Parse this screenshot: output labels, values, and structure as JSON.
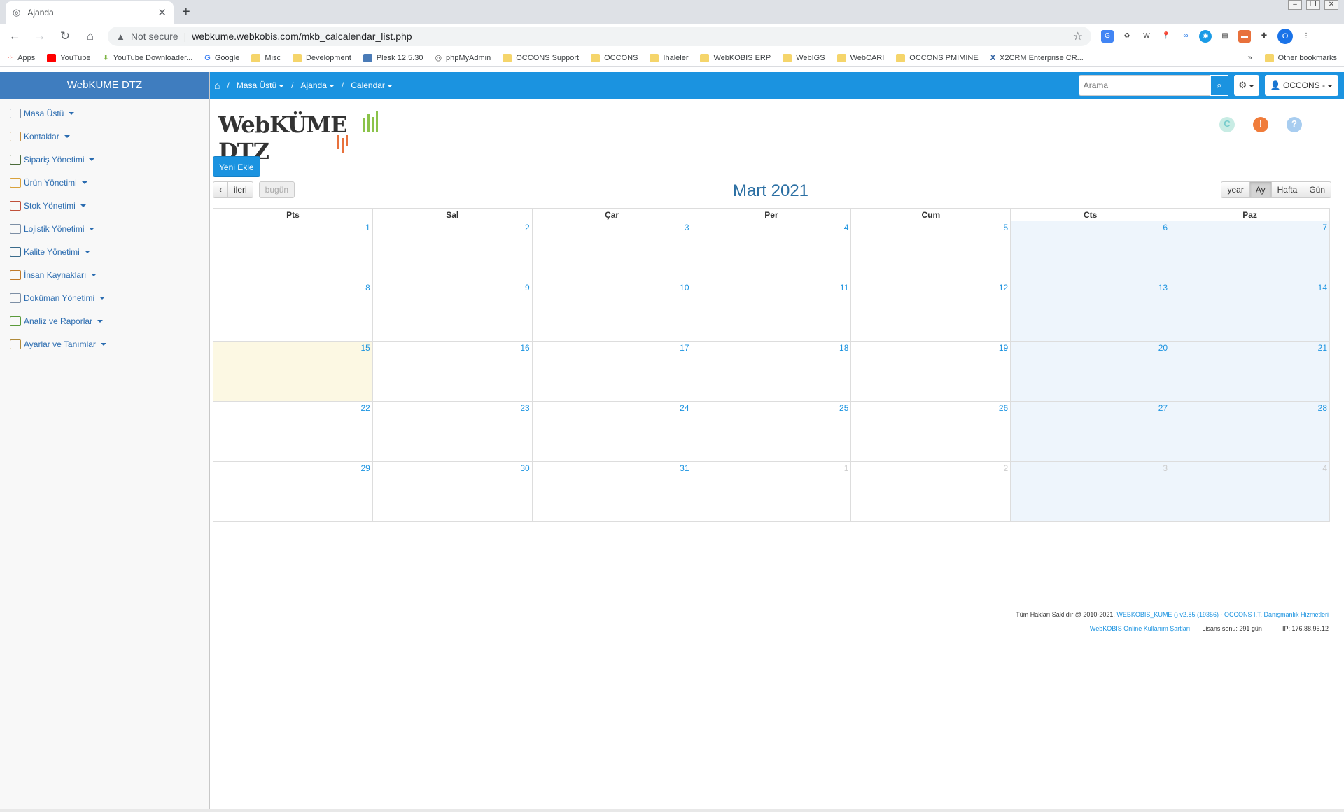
{
  "browser": {
    "tab_title": "Ajanda",
    "security_label": "Not secure",
    "url": "webkume.webkobis.com/mkb_calcalendar_list.php",
    "profile_initial": "O",
    "bookmarks": [
      "Apps",
      "YouTube",
      "YouTube Downloader...",
      "Google",
      "Misc",
      "Development",
      "Plesk 12.5.30",
      "phpMyAdmin",
      "OCCONS Support",
      "OCCONS",
      "Ihaleler",
      "WebKOBIS ERP",
      "WebIGS",
      "WebCARI",
      "OCCONS PMIMINE",
      "X2CRM Enterprise CR..."
    ],
    "more_bookmarks": "»",
    "other_bookmarks": "Other bookmarks"
  },
  "sidebar": {
    "brand": "WebKUME DTZ",
    "items": [
      {
        "label": "Masa Üstü",
        "icon": "desktop-icon"
      },
      {
        "label": "Kontaklar",
        "icon": "contacts-icon"
      },
      {
        "label": "Sipariş Yönetimi",
        "icon": "orders-icon"
      },
      {
        "label": "Ürün Yönetimi",
        "icon": "products-icon"
      },
      {
        "label": "Stok Yönetimi",
        "icon": "stock-icon"
      },
      {
        "label": "Lojistik Yönetimi",
        "icon": "logistics-icon"
      },
      {
        "label": "Kalite Yönetimi",
        "icon": "quality-icon"
      },
      {
        "label": "İnsan Kaynakları",
        "icon": "hr-icon"
      },
      {
        "label": "Doküman Yönetimi",
        "icon": "documents-icon"
      },
      {
        "label": "Analiz ve Raporlar",
        "icon": "reports-icon"
      },
      {
        "label": "Ayarlar ve Tanımlar",
        "icon": "settings-icon"
      }
    ]
  },
  "topnav": {
    "breadcrumb": [
      "Masa Üstü",
      "Ajanda",
      "Calendar"
    ],
    "separator": "/",
    "search_placeholder": "Arama",
    "user_label": "OCCONS -"
  },
  "logo": {
    "text": "WebKÜME DTZ"
  },
  "actions": {
    "new_label": "Yeni Ekle"
  },
  "calendar": {
    "title": "Mart 2021",
    "nav": {
      "prev": "‹",
      "next": "ileri",
      "today": "bugün"
    },
    "views": [
      "year",
      "Ay",
      "Hafta",
      "Gün"
    ],
    "active_view": "Ay",
    "weekdays": [
      "Pts",
      "Sal",
      "Çar",
      "Per",
      "Cum",
      "Cts",
      "Paz"
    ],
    "weeks": [
      [
        "1",
        "2",
        "3",
        "4",
        "5",
        "6",
        "7"
      ],
      [
        "8",
        "9",
        "10",
        "11",
        "12",
        "13",
        "14"
      ],
      [
        "15",
        "16",
        "17",
        "18",
        "19",
        "20",
        "21"
      ],
      [
        "22",
        "23",
        "24",
        "25",
        "26",
        "27",
        "28"
      ],
      [
        "29",
        "30",
        "31",
        "1",
        "2",
        "3",
        "4"
      ]
    ],
    "today": "15"
  },
  "footer": {
    "copyright": "Tüm Hakları Saklıdır @ 2010-2021.",
    "version_link": "WEBKOBIS_KUME () v2.85 (19356) - OCCONS I.T. Danışmanlık Hizmetleri",
    "terms_link": "WebKOBIS Online Kullanım Şartları",
    "license": "Lisans sonu: 291 gün",
    "ip": "IP: 176.88.95.12"
  },
  "colors": {
    "primary": "#1b93e0",
    "brand_bar": "#3f7dbf",
    "weekend": "#eef5fc",
    "today": "#fcf8e3"
  }
}
